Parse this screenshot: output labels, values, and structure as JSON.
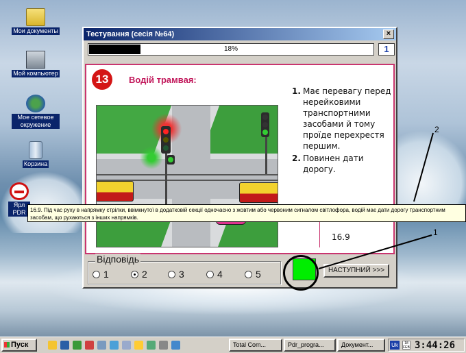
{
  "desktop": {
    "icons": [
      {
        "label": "Мои документы",
        "icon": "folder-documents-icon"
      },
      {
        "label": "Мой компьютер",
        "icon": "computer-icon"
      },
      {
        "label": "Мое сетевое окружение",
        "icon": "network-icon"
      },
      {
        "label": "Корзина",
        "icon": "recycle-bin-icon"
      },
      {
        "label": "Ярл PDR",
        "icon": "no-entry-sign-icon"
      }
    ]
  },
  "window": {
    "title": "Тестування (сесія №64)",
    "close_label": "×",
    "progress_text": "18%",
    "progress_value": 0.18,
    "question_counter": "1"
  },
  "question": {
    "number": "13",
    "title": "Водій трамвая:",
    "answers": [
      {
        "num": "1.",
        "text": "Має перевагу перед нерейковими транспортними засобами й тому проїде перехрестя першим."
      },
      {
        "num": "2.",
        "text": "Повинен дати дорогу."
      }
    ],
    "reference": "16.9"
  },
  "answer_group": {
    "legend": "Відповідь",
    "options": [
      "1",
      "2",
      "3",
      "4",
      "5"
    ],
    "selected_index": 1
  },
  "status_color": "#00ee00",
  "next_button_label": "НАСТУПНИЙ >>>",
  "tooltip": "16.9. Під час руху в напрямку стрілки, ввімкнутої в додатковій секції одночасно з жовтим або червоним сигналом світлофора, водій має дати дорогу транспортним засобам, що рухаються з інших напрямків.",
  "annotations": {
    "label1": "1",
    "label2": "2"
  },
  "taskbar": {
    "start_label": "Пуск",
    "tasks": [
      "Total Com...",
      "Pdr_progra...",
      "Документ..."
    ],
    "lang": "Uk",
    "calendar_day": "18",
    "calendar_month": "FEB",
    "clock": "3:44:26"
  }
}
